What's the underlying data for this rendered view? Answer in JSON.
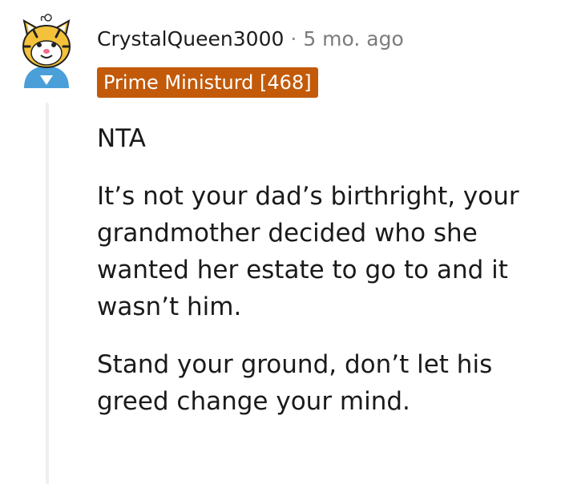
{
  "comment": {
    "username": "CrystalQueen3000",
    "separator": "·",
    "timestamp": "5 mo. ago",
    "flair": "Prime Ministurd [468]",
    "flair_color": "#c25a09",
    "avatar_icon": "tiger-avatar-icon",
    "paragraphs": [
      "NTA",
      "It’s not your dad’s birthright, your grandmother decided who she wanted her estate to go to and it wasn’t him.",
      "Stand your ground, don’t let his greed change your mind."
    ]
  }
}
